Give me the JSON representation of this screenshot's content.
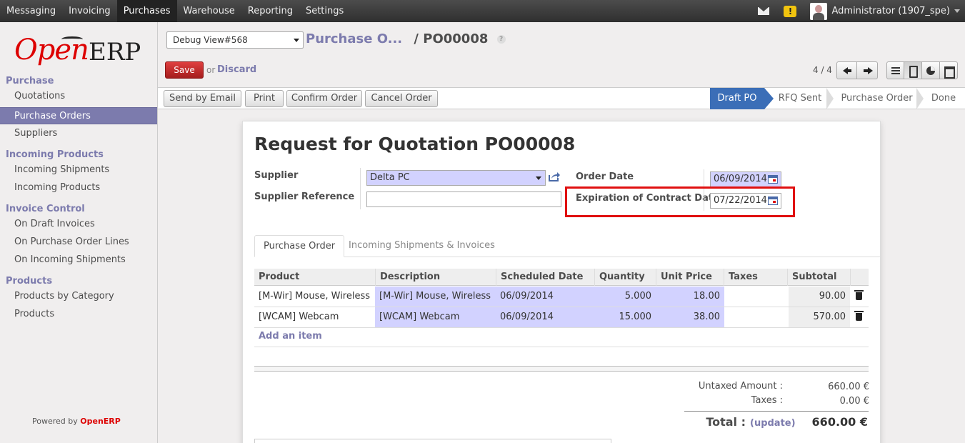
{
  "topbar": {
    "menu": [
      "Messaging",
      "Invoicing",
      "Purchases",
      "Warehouse",
      "Reporting",
      "Settings"
    ],
    "active_menu": "Purchases",
    "warning_badge": "!",
    "user": "Administrator (1907_spe)"
  },
  "sidebar": {
    "logo_open": "Open",
    "logo_erp": "ERP",
    "sections": [
      {
        "title": "Purchase",
        "items": [
          "Quotations",
          "Purchase Orders",
          "Suppliers"
        ]
      },
      {
        "title": "Incoming Products",
        "items": [
          "Incoming Shipments",
          "Incoming Products"
        ]
      },
      {
        "title": "Invoice Control",
        "items": [
          "On Draft Invoices",
          "On Purchase Order Lines",
          "On Incoming Shipments"
        ]
      },
      {
        "title": "Products",
        "items": [
          "Products by Category",
          "Products"
        ]
      }
    ],
    "active_item": "Purchase Orders",
    "powered_prefix": "Powered by",
    "powered_brand": "OpenERP"
  },
  "control_panel": {
    "view_select": "Debug View#568",
    "breadcrumb_parent": "Purchase O...",
    "breadcrumb_sep": "/",
    "breadcrumb_current": "PO00008",
    "help": "?",
    "save_label": "Save",
    "or_label": "or",
    "discard_label": "Discard",
    "pager": "4 / 4"
  },
  "statusbar": {
    "buttons": [
      "Send by Email",
      "Print",
      "Confirm Order",
      "Cancel Order"
    ],
    "stages": [
      "Draft PO",
      "RFQ Sent",
      "Purchase Order",
      "Done"
    ],
    "current_stage": "Draft PO"
  },
  "form": {
    "title_prefix": "Request for Quotation",
    "title_ref": "PO00008",
    "supplier_label": "Supplier",
    "supplier_value": "Delta PC",
    "supplier_ref_label": "Supplier Reference",
    "supplier_ref_value": "",
    "order_date_label": "Order Date",
    "order_date_value": "06/09/2014",
    "expiration_label": "Expiration of Contract Date",
    "expiration_value": "07/22/2014"
  },
  "tabs": [
    "Purchase Order",
    "Incoming Shipments & Invoices"
  ],
  "active_tab": "Purchase Order",
  "order_lines": {
    "columns": [
      "Product",
      "Description",
      "Scheduled Date",
      "Quantity",
      "Unit Price",
      "Taxes",
      "Subtotal"
    ],
    "rows": [
      {
        "product": "[M-Wir] Mouse, Wireless",
        "description": "[M-Wir] Mouse, Wireless",
        "date": "06/09/2014",
        "quantity": "5.000",
        "unit_price": "18.00",
        "taxes": "",
        "subtotal": "90.00"
      },
      {
        "product": "[WCAM] Webcam",
        "description": "[WCAM] Webcam",
        "date": "06/09/2014",
        "quantity": "15.000",
        "unit_price": "38.00",
        "taxes": "",
        "subtotal": "570.00"
      }
    ],
    "add_item": "Add an item"
  },
  "totals": {
    "untaxed_label": "Untaxed Amount :",
    "untaxed_value": "660.00 €",
    "taxes_label": "Taxes :",
    "taxes_value": "0.00 €",
    "total_label": "Total :",
    "update_label": "(update)",
    "total_value": "660.00 €"
  },
  "colors": {
    "accent": "#7c7bad",
    "save": "#c62828",
    "stage_current": "#3b6eb7",
    "readonly_field": "#d2d2ff",
    "highlight": "#e01010"
  }
}
